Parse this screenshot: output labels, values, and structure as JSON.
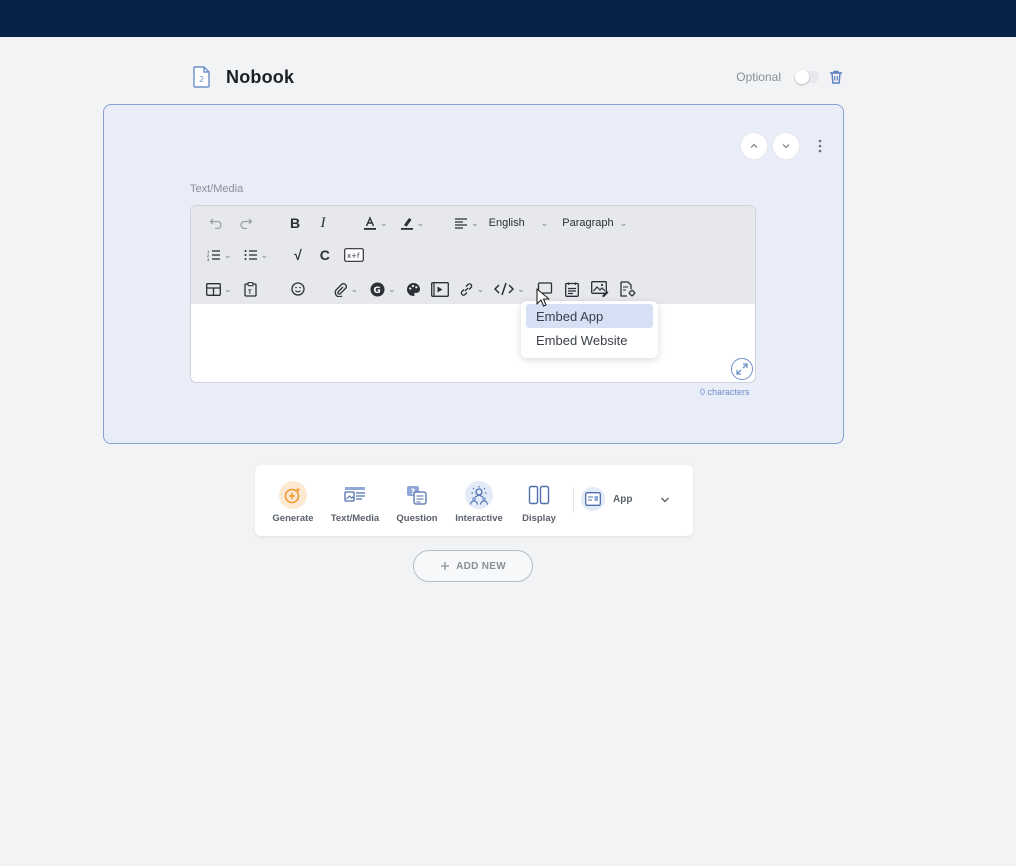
{
  "header": {
    "title": "Nobook",
    "optional_label": "Optional"
  },
  "editor": {
    "field_label": "Text/Media",
    "language_select": "English",
    "block_format_select": "Paragraph",
    "char_count": "0 characters"
  },
  "embed_dropdown": {
    "items": [
      "Embed App",
      "Embed Website"
    ],
    "active_index": 0
  },
  "palette": {
    "items": [
      {
        "label": "Generate",
        "icon": "generate-icon"
      },
      {
        "label": "Text/Media",
        "icon": "text-media-icon"
      },
      {
        "label": "Question",
        "icon": "question-icon"
      },
      {
        "label": "Interactive",
        "icon": "interactive-icon"
      },
      {
        "label": "Display",
        "icon": "display-icon"
      }
    ],
    "app_label": "App"
  },
  "add_new_label": "ADD NEW",
  "colors": {
    "topbar": "#062349",
    "card_bg": "#e9edf7",
    "card_border": "#8aa0cf",
    "accent": "#6d8fc7",
    "generate_orange": "#f0962e"
  }
}
